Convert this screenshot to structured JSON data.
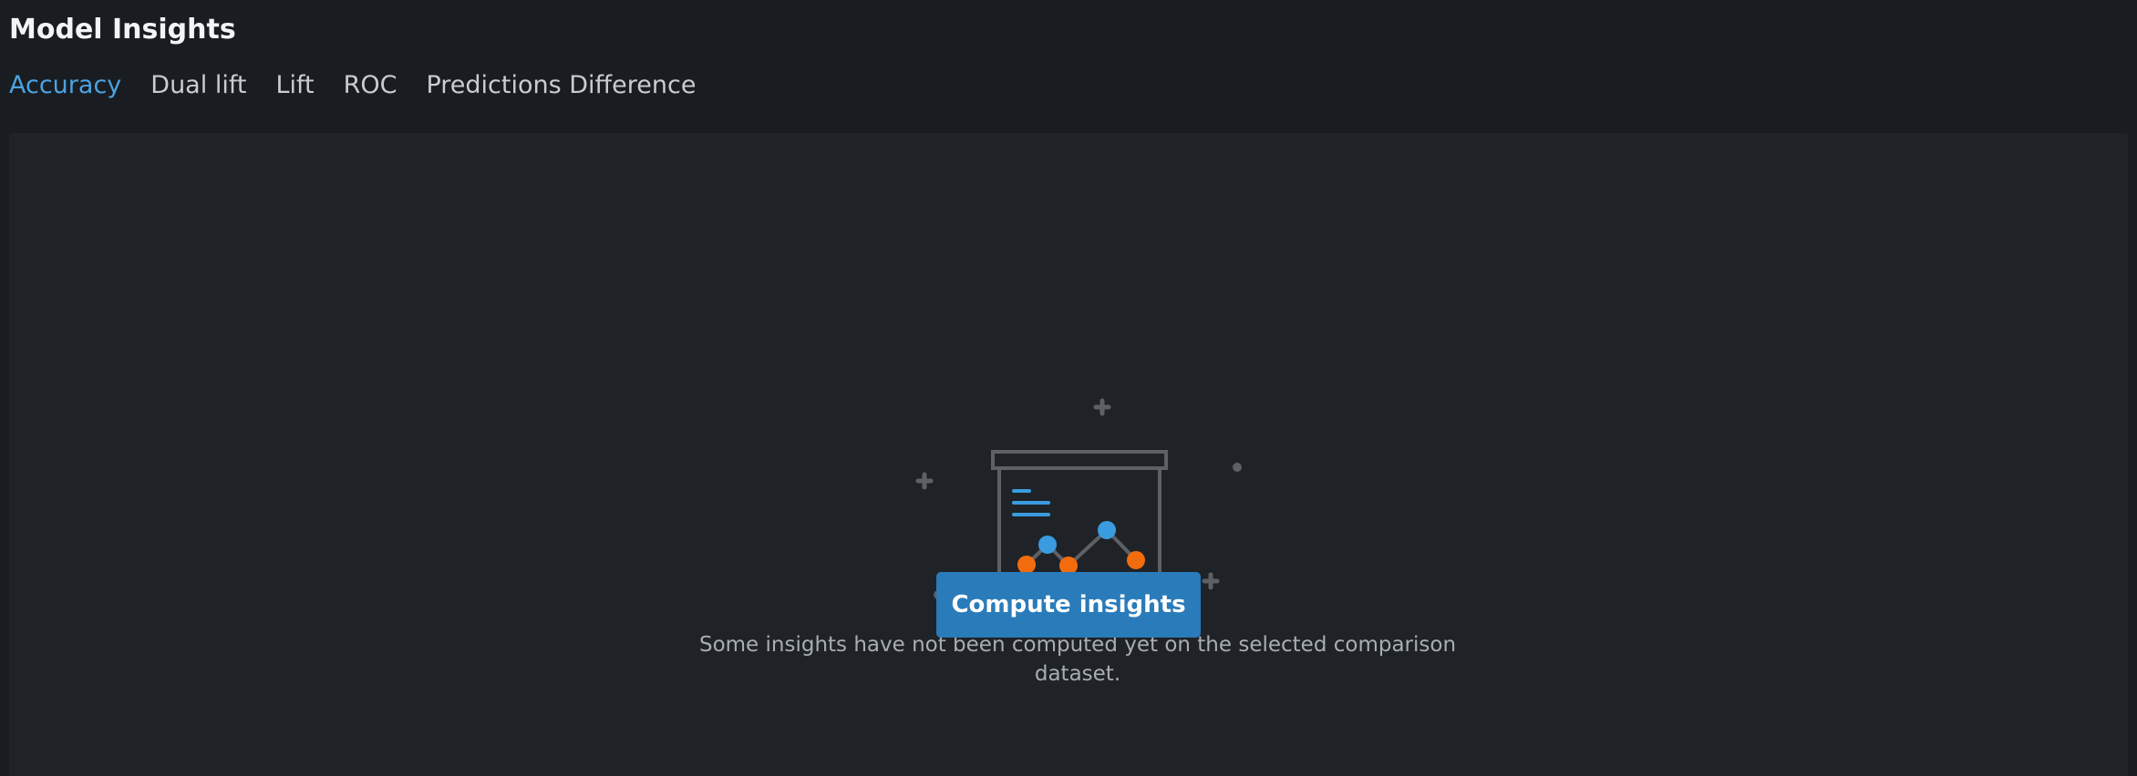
{
  "page": {
    "title": "Model Insights"
  },
  "tabs": [
    {
      "label": "Accuracy",
      "active": true
    },
    {
      "label": "Dual lift",
      "active": false
    },
    {
      "label": "Lift",
      "active": false
    },
    {
      "label": "ROC",
      "active": false
    },
    {
      "label": "Predictions Difference",
      "active": false
    }
  ],
  "empty_state": {
    "icon": "presentation-chart-illustration",
    "message": "Some insights have not been computed yet on the selected comparison dataset.",
    "button_label": "Compute insights"
  },
  "colors": {
    "background": "#191d21",
    "panel": "#1f2328",
    "accent": "#4ba3e3",
    "button": "#2a7bba",
    "chart_blue": "#3a9be0",
    "chart_orange": "#f26c0d",
    "illustration_stroke": "#5d6166"
  }
}
